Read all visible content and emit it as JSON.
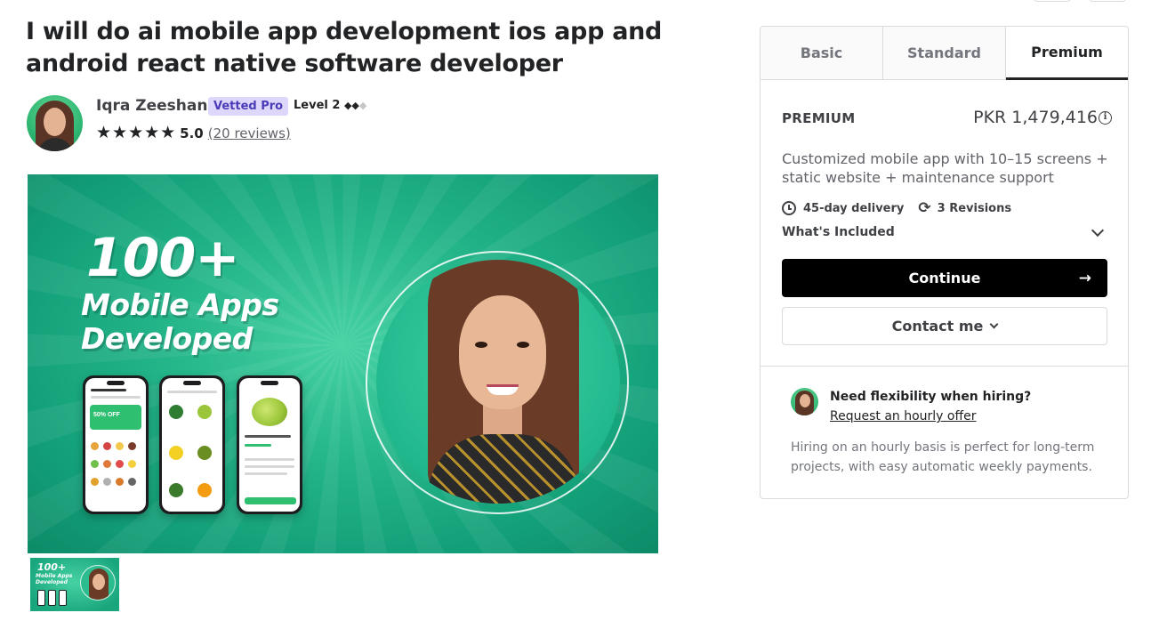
{
  "gig": {
    "title": "I will do ai mobile app development ios app and android react native software developer"
  },
  "seller": {
    "name": "Iqra Zeeshan",
    "badge": "Vetted Pro",
    "level": "Level 2",
    "level_diamonds_on": "◆◆",
    "level_diamonds_off": "◆",
    "stars": "★★★★★",
    "rating": "5.0",
    "reviews": "(20 reviews)"
  },
  "hero": {
    "headline_number": "100+",
    "headline_line2": "Mobile Apps",
    "headline_line3": "Developed",
    "promo_badge": "50% OFF"
  },
  "thumbnail": {
    "line1": "100+",
    "line2": "Mobile Apps",
    "line3": "Developed"
  },
  "package_tabs": [
    {
      "label": "Basic",
      "active": false
    },
    {
      "label": "Standard",
      "active": false
    },
    {
      "label": "Premium",
      "active": true
    }
  ],
  "package": {
    "name": "PREMIUM",
    "price": "PKR 1,479,416",
    "description": "Customized mobile app with 10–15 screens + static website + maintenance support",
    "delivery": "45-day delivery",
    "revisions": "3 Revisions",
    "whats_included": "What's Included",
    "continue_label": "Continue",
    "continue_arrow": "→",
    "contact_label": "Contact me"
  },
  "hourly": {
    "title": "Need flexibility when hiring?",
    "link": "Request an hourly offer",
    "description": "Hiring on an hourly basis is perfect for long-term projects, with easy automatic weekly payments."
  },
  "icons": {
    "info": "i",
    "revisions": "⟳"
  },
  "colors": {
    "brand_black": "#000000",
    "vetted_bg": "#ddd8fb",
    "vetted_text": "#4a3bb7",
    "hero_green": "#27b88c"
  }
}
